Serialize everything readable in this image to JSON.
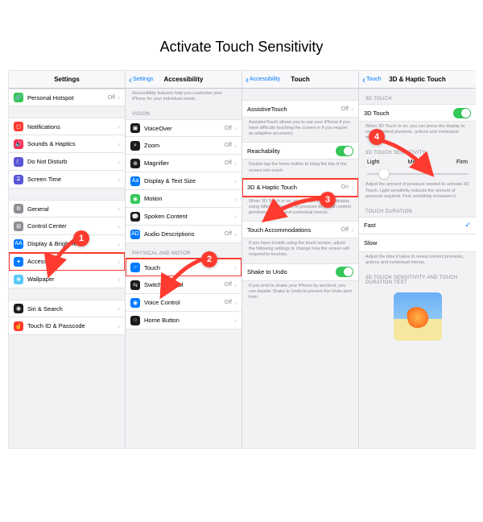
{
  "page_title": "Activate Touch Sensitivity",
  "panes": {
    "p1": {
      "header_title": "Settings",
      "rows": [
        {
          "label": "Personal Hotspot",
          "val": "Off",
          "icon_bg": "#34c759",
          "icon": "🔗"
        },
        {
          "label": "Notifications",
          "icon_bg": "#ff3b30",
          "icon": "◻︎"
        },
        {
          "label": "Sounds & Haptics",
          "icon_bg": "#ff2d55",
          "icon": "🔊"
        },
        {
          "label": "Do Not Disturb",
          "icon_bg": "#5856d6",
          "icon": "☾"
        },
        {
          "label": "Screen Time",
          "icon_bg": "#5856d6",
          "icon": "⌛︎"
        },
        {
          "label": "General",
          "icon_bg": "#8e8e93",
          "icon": "⚙︎"
        },
        {
          "label": "Control Center",
          "icon_bg": "#8e8e93",
          "icon": "⊞"
        },
        {
          "label": "Display & Brightness",
          "icon_bg": "#007aff",
          "icon": "AA"
        },
        {
          "label": "Accessibility",
          "icon_bg": "#007aff",
          "icon": "✦"
        },
        {
          "label": "Wallpaper",
          "icon_bg": "#5ac8fa",
          "icon": "❀"
        },
        {
          "label": "Siri & Search",
          "icon_bg": "#1c1c1e",
          "icon": "◉"
        },
        {
          "label": "Touch ID & Passcode",
          "icon_bg": "#ff3b30",
          "icon": "☝"
        }
      ]
    },
    "p2": {
      "header_back": "Settings",
      "header_title": "Accessibility",
      "intro": "Accessibility features help you customize your iPhone for your individual needs.",
      "group1_label": "VISION",
      "group1": [
        {
          "label": "VoiceOver",
          "val": "Off",
          "icon_bg": "#1c1c1e",
          "icon": "▣"
        },
        {
          "label": "Zoom",
          "val": "Off",
          "icon_bg": "#1c1c1e",
          "icon": "⌕"
        },
        {
          "label": "Magnifier",
          "val": "Off",
          "icon_bg": "#1c1c1e",
          "icon": "⊕"
        },
        {
          "label": "Display & Text Size",
          "icon_bg": "#007aff",
          "icon": "Aa"
        },
        {
          "label": "Motion",
          "icon_bg": "#34c759",
          "icon": "◉"
        },
        {
          "label": "Spoken Content",
          "icon_bg": "#1c1c1e",
          "icon": "💬"
        },
        {
          "label": "Audio Descriptions",
          "val": "Off",
          "icon_bg": "#007aff",
          "icon": "AD"
        }
      ],
      "group2_label": "PHYSICAL AND MOTOR",
      "group2": [
        {
          "label": "Touch",
          "icon_bg": "#007aff",
          "icon": "☞"
        },
        {
          "label": "Switch Control",
          "val": "Off",
          "icon_bg": "#1c1c1e",
          "icon": "⇆"
        },
        {
          "label": "Voice Control",
          "val": "Off",
          "icon_bg": "#007aff",
          "icon": "◉"
        },
        {
          "label": "Home Button",
          "icon_bg": "#1c1c1e",
          "icon": "○"
        }
      ]
    },
    "p3": {
      "header_back": "Accessibility",
      "header_title": "Touch",
      "assistive_label": "AssistiveTouch",
      "assistive_val": "Off",
      "assistive_help": "AssistiveTouch allows you to use your iPhone if you have difficulty touching the screen or if you require an adaptive accessory.",
      "reachability_label": "Reachability",
      "reachability_help": "Double-tap the home button to bring the top of the screen into reach.",
      "haptic_label": "3D & Haptic Touch",
      "haptic_val": "On",
      "haptic_help": "When 3D Touch is on, you can press on the display using different degrees of pressure to reveal content previews, actions and contextual menus.",
      "accom_label": "Touch Accommodations",
      "accom_val": "Off",
      "accom_help": "If you have trouble using the touch screen, adjust the following settings to change how the screen will respond to touches.",
      "shake_label": "Shake to Undo",
      "shake_help": "If you tend to shake your iPhone by accident, you can disable Shake to Undo to prevent the Undo alert from"
    },
    "p4": {
      "header_back": "Touch",
      "header_title": "3D & Haptic Touch",
      "g1_label": "3D TOUCH",
      "switch_label": "3D Touch",
      "switch_help": "When 3D Touch is on, you can press the display to reveal content previews, actions and contextual menus.",
      "g2_label": "3D TOUCH SENSITIVITY",
      "seg": [
        "Light",
        "Medium",
        "Firm"
      ],
      "slider_pos_pct": 12,
      "seg_help": "Adjust the amount of pressure needed to activate 3D Touch. Light sensitivity reduces the amount of pressure required. Firm sensitivity increases it.",
      "g3_label": "TOUCH DURATION",
      "dur": [
        "Fast",
        "Slow"
      ],
      "dur_selected": 0,
      "dur_help": "Adjust the time it takes to reveal content previews, actions and contextual menus.",
      "g4_label": "3D TOUCH SENSITIVITY AND TOUCH DURATION TEST"
    }
  },
  "steps": [
    "1",
    "2",
    "3",
    "4"
  ]
}
